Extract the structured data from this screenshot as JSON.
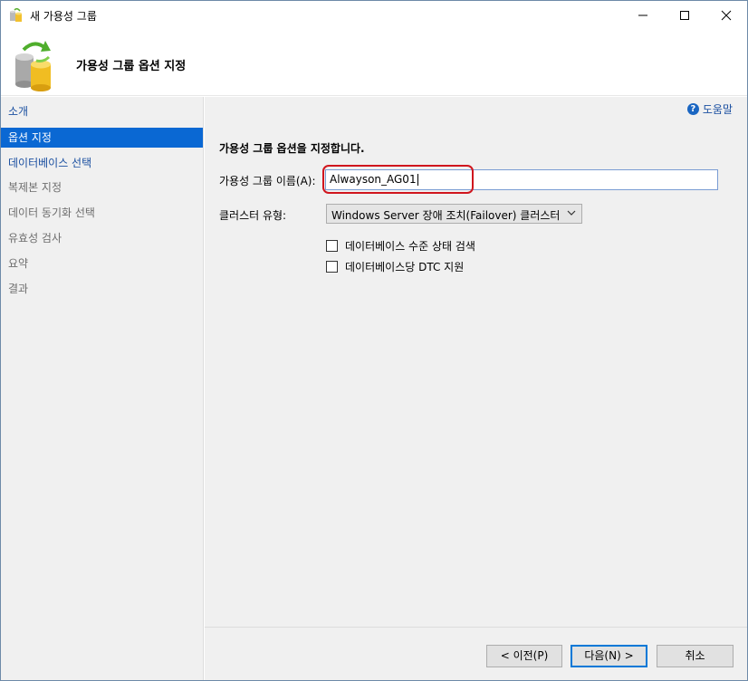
{
  "window": {
    "title": "새 가용성 그룹",
    "icon": "database-icon",
    "controls": [
      "minimize-icon",
      "maximize-icon",
      "close-icon"
    ]
  },
  "banner": {
    "title": "가용성 그룹 옵션 지정",
    "icon": "database-sync-icon"
  },
  "nav": {
    "items": [
      {
        "label": "소개",
        "state": "link"
      },
      {
        "label": "옵션 지정",
        "state": "selected"
      },
      {
        "label": "데이터베이스 선택",
        "state": "link"
      },
      {
        "label": "복제본 지정",
        "state": "disabled"
      },
      {
        "label": "데이터 동기화 선택",
        "state": "disabled"
      },
      {
        "label": "유효성 검사",
        "state": "disabled"
      },
      {
        "label": "요약",
        "state": "disabled"
      },
      {
        "label": "결과",
        "state": "disabled"
      }
    ]
  },
  "content": {
    "help_label": "도움말",
    "section_title": "가용성 그룹 옵션을 지정합니다.",
    "name_label": "가용성 그룹 이름(A):",
    "name_value": "Alwayson_AG01",
    "cluster_label": "클러스터 유형:",
    "cluster_value": "Windows Server 장애 조치(Failover) 클러스터",
    "checkboxes": [
      {
        "label": "데이터베이스 수준 상태 검색",
        "checked": false
      },
      {
        "label": "데이터베이스당 DTC 지원",
        "checked": false
      }
    ]
  },
  "footer": {
    "prev": "< 이전(P)",
    "next": "다음(N) >",
    "cancel": "취소"
  },
  "colors": {
    "selected_nav": "#0a68d3",
    "link": "#1a4fa0",
    "highlight": "#d0161e"
  }
}
